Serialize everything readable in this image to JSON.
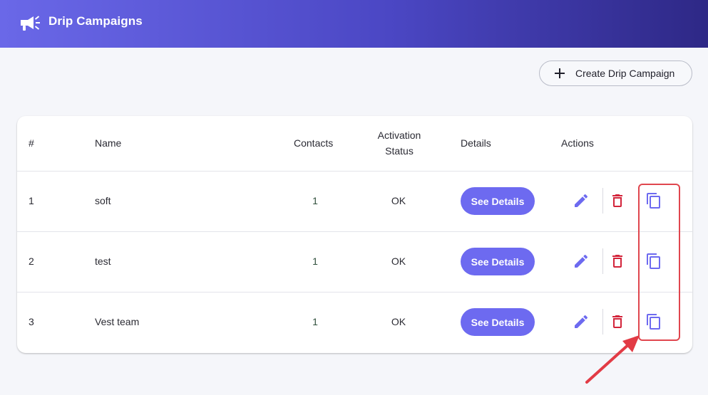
{
  "header": {
    "title": "Drip Campaigns",
    "logo_icon": "megaphone-icon",
    "gradient_start": "#6a68e8",
    "gradient_end": "#2e2886"
  },
  "toolbar": {
    "create_label": "Create Drip Campaign",
    "create_icon": "plus-icon"
  },
  "table": {
    "headers": {
      "index": "#",
      "name": "Name",
      "contacts": "Contacts",
      "status_line1": "Activation",
      "status_line2": "Status",
      "details": "Details",
      "actions": "Actions"
    },
    "rows": [
      {
        "index": "1",
        "name": "soft",
        "contacts": "1",
        "status": "OK",
        "details_label": "See Details"
      },
      {
        "index": "2",
        "name": "test",
        "contacts": "1",
        "status": "OK",
        "details_label": "See Details"
      },
      {
        "index": "3",
        "name": "Vest team",
        "contacts": "1",
        "status": "OK",
        "details_label": "See Details"
      }
    ],
    "action_icons": [
      "edit-pencil-icon",
      "delete-trash-icon",
      "duplicate-copy-icon"
    ]
  },
  "colors": {
    "accent": "#6d6af0",
    "delete": "#d3243a",
    "highlight": "#e0464e"
  }
}
